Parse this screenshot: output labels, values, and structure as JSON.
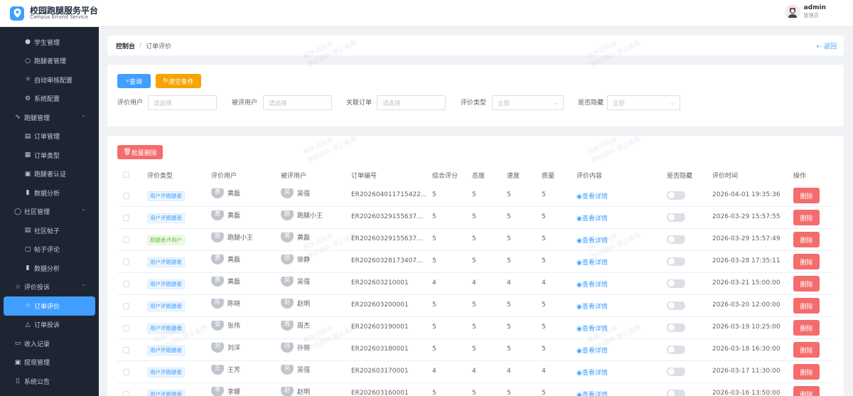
{
  "app": {
    "title": "校园跑腿服务平台",
    "subtitle": "Campus Errand Service",
    "brand_color": "#409eff"
  },
  "user": {
    "name": "admin",
    "role": "管理员"
  },
  "sidebar": {
    "items": [
      {
        "label": "学生管理",
        "icon": "user-icon",
        "level": "sub"
      },
      {
        "label": "跑腿者管理",
        "icon": "user-outline-icon",
        "level": "sub"
      },
      {
        "label": "自动审核配置",
        "icon": "sun-gear-icon",
        "level": "sub"
      },
      {
        "label": "系统配置",
        "icon": "settings-icon",
        "level": "sub"
      },
      {
        "label": "跑腿管理",
        "icon": "pulse-icon",
        "level": "top",
        "expanded": true
      },
      {
        "label": "订单管理",
        "icon": "document-icon",
        "level": "sub"
      },
      {
        "label": "订单类型",
        "icon": "grid-icon",
        "level": "sub"
      },
      {
        "label": "跑腿者认证",
        "icon": "id-card-icon",
        "level": "sub"
      },
      {
        "label": "数据分析",
        "icon": "bar-chart-icon",
        "level": "sub"
      },
      {
        "label": "社区管理",
        "icon": "chat-icon",
        "level": "top",
        "expanded": true
      },
      {
        "label": "社区帖子",
        "icon": "document-icon",
        "level": "sub"
      },
      {
        "label": "帖子评论",
        "icon": "comment-icon",
        "level": "sub"
      },
      {
        "label": "数据分析",
        "icon": "bar-chart-icon",
        "level": "sub"
      },
      {
        "label": "评价投诉",
        "icon": "star-icon",
        "level": "top",
        "expanded": true
      },
      {
        "label": "订单评价",
        "icon": "star-icon",
        "level": "sub",
        "active": true
      },
      {
        "label": "订单投诉",
        "icon": "warning-icon",
        "level": "sub"
      },
      {
        "label": "收入记录",
        "icon": "wallet-icon",
        "level": "top"
      },
      {
        "label": "提现管理",
        "icon": "money-icon",
        "level": "top"
      },
      {
        "label": "系统公告",
        "icon": "bell-icon",
        "level": "top"
      }
    ]
  },
  "breadcrumb": {
    "first": "控制台",
    "separator": "/",
    "current": "订单评价",
    "back": "返回"
  },
  "filters": {
    "query_btn": "查询",
    "clear_btn": "清空条件",
    "fields": [
      {
        "label": "评价用户",
        "placeholder": "请选择"
      },
      {
        "label": "被评用户",
        "placeholder": "请选择"
      },
      {
        "label": "关联订单",
        "placeholder": "请选择"
      },
      {
        "label": "评价类型",
        "placeholder": "全部"
      },
      {
        "label": "是否隐藏",
        "placeholder": "全部"
      }
    ]
  },
  "table": {
    "batch_delete": "批量删除",
    "columns": [
      "评价类型",
      "评价用户",
      "被评用户",
      "订单编号",
      "综合评分",
      "态度",
      "速度",
      "质量",
      "评价内容",
      "是否隐藏",
      "评价时间",
      "操作"
    ],
    "view_label": "查看详情",
    "delete_label": "删除",
    "rows": [
      {
        "type": "用户评跑腿者",
        "tag": "blue",
        "reviewer": "黄磊",
        "reviewer_av": "黄",
        "reviewee": "吴强",
        "reviewee_av": "吴",
        "order": "ER202604011715422...",
        "score": "5",
        "attitude": "5",
        "speed": "5",
        "quality": "5",
        "hidden": false,
        "time": "2026-04-01 19:35:36"
      },
      {
        "type": "用户评跑腿者",
        "tag": "blue",
        "reviewer": "黄磊",
        "reviewer_av": "黄",
        "reviewee": "跑腿小王",
        "reviewee_av": "跑",
        "order": "ER20260329155637...",
        "score": "5",
        "attitude": "5",
        "speed": "5",
        "quality": "5",
        "hidden": false,
        "time": "2026-03-29 15:57:55"
      },
      {
        "type": "跑腿者评用户",
        "tag": "green",
        "reviewer": "跑腿小王",
        "reviewer_av": "跑",
        "reviewee": "黄磊",
        "reviewee_av": "黄",
        "order": "ER20260329155637...",
        "score": "5",
        "attitude": "5",
        "speed": "5",
        "quality": "5",
        "hidden": false,
        "time": "2026-03-29 15:57:49"
      },
      {
        "type": "用户评跑腿者",
        "tag": "blue",
        "reviewer": "黄磊",
        "reviewer_av": "黄",
        "reviewee": "徐静",
        "reviewee_av": "徐",
        "order": "ER20260328173407...",
        "score": "5",
        "attitude": "5",
        "speed": "5",
        "quality": "5",
        "hidden": false,
        "time": "2026-03-28 17:35:11"
      },
      {
        "type": "用户评跑腿者",
        "tag": "blue",
        "reviewer": "黄磊",
        "reviewer_av": "黄",
        "reviewee": "吴强",
        "reviewee_av": "吴",
        "order": "ER202603210001",
        "score": "4",
        "attitude": "4",
        "speed": "4",
        "quality": "4",
        "hidden": false,
        "time": "2026-03-21 15:00:00"
      },
      {
        "type": "用户评跑腿者",
        "tag": "blue",
        "reviewer": "陈晓",
        "reviewer_av": "陈",
        "reviewee": "赵明",
        "reviewee_av": "赵",
        "order": "ER202603200001",
        "score": "5",
        "attitude": "5",
        "speed": "5",
        "quality": "5",
        "hidden": false,
        "time": "2026-03-20 12:00:00"
      },
      {
        "type": "用户评跑腿者",
        "tag": "blue",
        "reviewer": "张伟",
        "reviewer_av": "张",
        "reviewee": "周杰",
        "reviewee_av": "周",
        "order": "ER202603190001",
        "score": "5",
        "attitude": "5",
        "speed": "5",
        "quality": "5",
        "hidden": false,
        "time": "2026-03-19 10:25:00"
      },
      {
        "type": "用户评跑腿者",
        "tag": "blue",
        "reviewer": "刘洋",
        "reviewer_av": "刘",
        "reviewee": "孙丽",
        "reviewee_av": "孙",
        "order": "ER202603180001",
        "score": "5",
        "attitude": "5",
        "speed": "5",
        "quality": "5",
        "hidden": false,
        "time": "2026-03-18 16:30:00"
      },
      {
        "type": "用户评跑腿者",
        "tag": "blue",
        "reviewer": "王芳",
        "reviewer_av": "王",
        "reviewee": "吴强",
        "reviewee_av": "吴",
        "order": "ER202603170001",
        "score": "4",
        "attitude": "4",
        "speed": "4",
        "quality": "4",
        "hidden": false,
        "time": "2026-03-17 11:30:00"
      },
      {
        "type": "用户评跑腿者",
        "tag": "blue",
        "reviewer": "李娜",
        "reviewer_av": "李",
        "reviewee": "赵明",
        "reviewee_av": "赵",
        "order": "ER202603160001",
        "score": "5",
        "attitude": "5",
        "speed": "5",
        "quality": "5",
        "hidden": false,
        "time": "2026-03-16 13:50:00"
      }
    ]
  },
  "watermark": {
    "line1": "程序员陈哥",
    "line2": "原创源码 禁止盗用"
  }
}
